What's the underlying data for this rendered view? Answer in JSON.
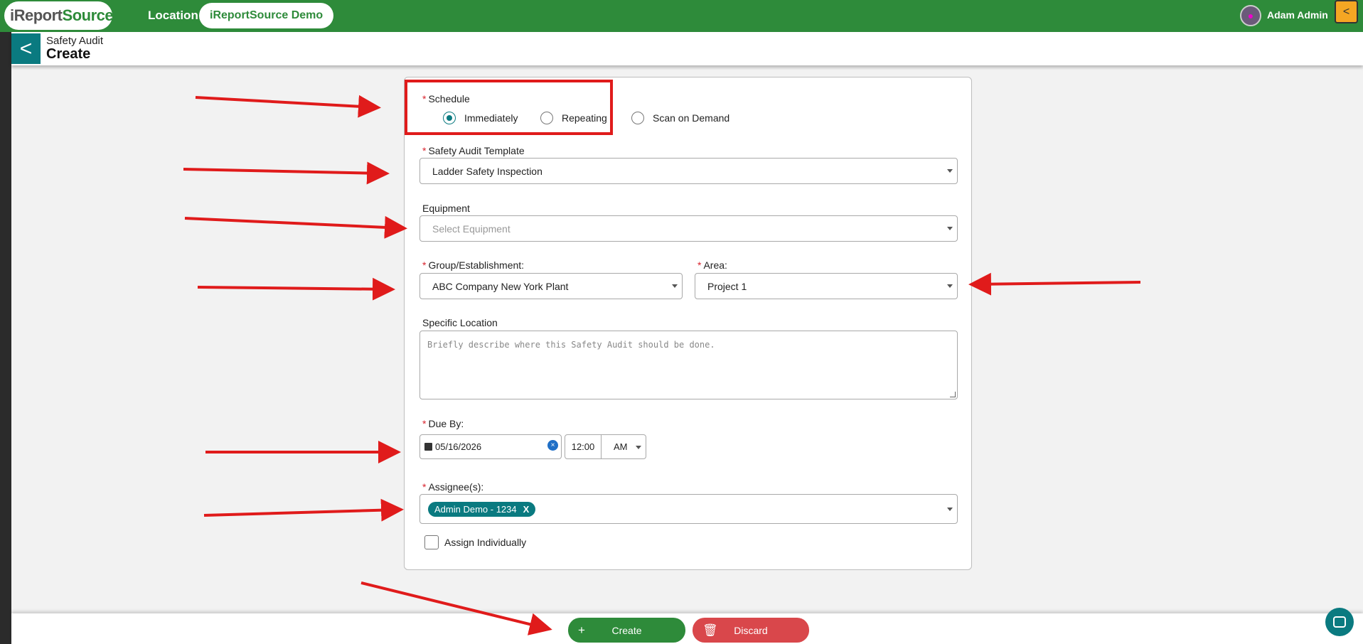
{
  "topbar": {
    "logo_text_left": "i",
    "logo_text_mid": "Report",
    "logo_text_right": "Source",
    "location_label": "Location:",
    "location_value": "iReportSource Demo",
    "user_name": "Adam Admin",
    "collapse_icon": "<"
  },
  "header": {
    "breadcrumb": "Safety Audit",
    "title": "Create",
    "back_icon": "<"
  },
  "form": {
    "schedule": {
      "label": "Schedule",
      "options": [
        "Immediately",
        "Repeating",
        "Scan on Demand"
      ],
      "selected": "Immediately"
    },
    "template": {
      "label": "Safety Audit Template",
      "value": "Ladder Safety Inspection"
    },
    "equipment": {
      "label": "Equipment",
      "placeholder": "Select Equipment"
    },
    "group": {
      "label": "Group/Establishment:",
      "value": "ABC Company New York Plant"
    },
    "area": {
      "label": "Area:",
      "value": "Project 1"
    },
    "specific_location": {
      "label": "Specific Location",
      "placeholder": "Briefly describe where this Safety Audit should be done."
    },
    "due_by": {
      "label": "Due By:",
      "date": "05/16/2026",
      "time": "12:00",
      "ampm": "AM",
      "clear_icon": "×"
    },
    "assignees": {
      "label": "Assignee(s):",
      "chip": "Admin Demo - 1234",
      "chip_remove": "X"
    },
    "assign_individually": {
      "label": "Assign Individually"
    },
    "required_marker": "*"
  },
  "actions": {
    "create_label": "Create",
    "create_icon": "+",
    "discard_label": "Discard",
    "discard_icon": "🗑"
  },
  "annotation_color": "#e01b1b"
}
